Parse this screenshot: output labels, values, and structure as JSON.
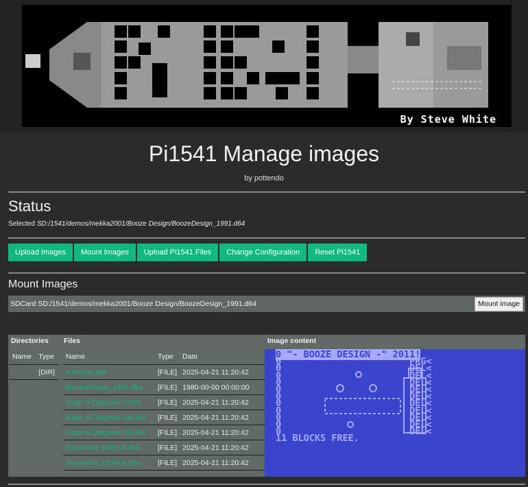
{
  "banner": {
    "byline": "By Steve White"
  },
  "header": {
    "title": "Pi1541 Manage images",
    "subtitle": "by pottendo"
  },
  "status": {
    "heading": "Status",
    "selected_label": "Selected",
    "selected_path": "SD:/1541/demos/mekka2001/Booze Design/BoozeDesign_1991.d64"
  },
  "toolbar": [
    "Upload Images",
    "Mount Images",
    "Upload Pi1541 Files",
    "Change Configuration",
    "Reset Pi1541"
  ],
  "mount": {
    "heading": "Mount Images",
    "path": "SDCard SD:/1541/demos/mekka2001/Booze Design/BoozeDesign_1991.d64",
    "button": "Mount image"
  },
  "browser": {
    "directories_header": "Directories",
    "files_header": "Files",
    "image_header": "Image content",
    "dir_columns": [
      "Name",
      "Type"
    ],
    "directories": [
      {
        "name": "..",
        "type": "[DIR]"
      }
    ],
    "file_columns": [
      "Name",
      "Type",
      "Date"
    ],
    "files": [
      {
        "name": "armalyte.d64",
        "type": "[FILE]",
        "date": "2025-04-21 11:20:42"
      },
      {
        "name": "BoozeDesign_1991.d64",
        "type": "[FILE]",
        "date": "1980-00-00 00:00:00"
      },
      {
        "name": "Edge of Disgrace 0.d64",
        "type": "[FILE]",
        "date": "2025-04-21 11:20:42"
      },
      {
        "name": "Edge of Disgrace 1A.d64",
        "type": "[FILE]",
        "date": "2025-04-21 11:20:42"
      },
      {
        "name": "Edge of Disgrace 1B.d64",
        "type": "[FILE]",
        "date": "2025-04-21 11:20:42"
      },
      {
        "name": "Royal Arte 100% A.d64",
        "type": "[FILE]",
        "date": "2025-04-21 11:20:42"
      },
      {
        "name": "Royal Arte 100% B.d64",
        "type": "[FILE]",
        "date": "2025-04-21 11:20:42"
      }
    ],
    "image_content": {
      "header_line": "0 \"- BOOZE DESIGN -\" 2011!",
      "entries": [
        {
          "blocks": "6",
          "type": "PRG<"
        },
        {
          "blocks": "0",
          "type": "DEL<"
        },
        {
          "blocks": "0",
          "type": "DEL<"
        },
        {
          "blocks": "0",
          "type": "DEL<"
        },
        {
          "blocks": "0",
          "type": "DEL<"
        },
        {
          "blocks": "0",
          "type": "DEL<"
        },
        {
          "blocks": "0",
          "type": "DEL<"
        },
        {
          "blocks": "0",
          "type": "DEL<"
        },
        {
          "blocks": "0",
          "type": "DEL<"
        },
        {
          "blocks": "0",
          "type": "DEL<"
        },
        {
          "blocks": "0",
          "type": "DEL<"
        }
      ],
      "footer": "11 BLOCKS FREE."
    }
  }
}
